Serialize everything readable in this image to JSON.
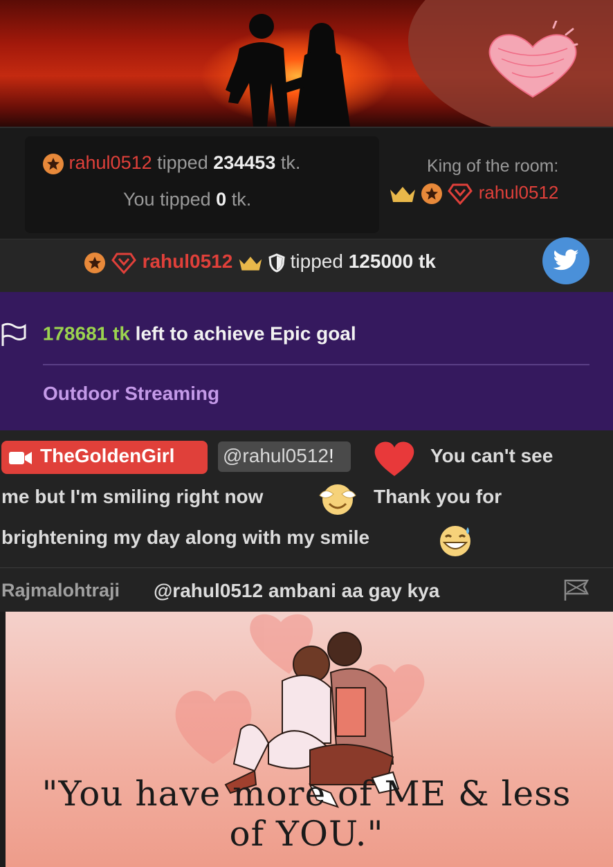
{
  "tip_summary": {
    "tipper": "rahul0512",
    "tipped_word": "tipped",
    "amount": "234453",
    "unit": "tk.",
    "you_tipped_label": "You tipped",
    "you_tipped_amount": "0",
    "you_tipped_unit": "tk.",
    "king_label": "King of the room:",
    "king_user": "rahul0512"
  },
  "tip_notification": {
    "user": "rahul0512",
    "tipped_word": "tipped",
    "amount": "125000 tk"
  },
  "goal": {
    "amount": "178681 tk",
    "text": "left to achieve Epic goal",
    "subtitle": "Outdoor Streaming"
  },
  "chat": [
    {
      "user": "TheGoldenGirl",
      "mention": "@rahul0512",
      "after_mention": "!",
      "line1_tail": "You can't see",
      "line2": "me but I'm smiling right now",
      "line2b": "Thank you for",
      "line3": "brightening my day along with my smile"
    },
    {
      "user": "Rajmalohtraji",
      "message": "@rahul0512  ambani aa gay kya"
    }
  ],
  "quote": {
    "line1": "\"You have more of ME & less",
    "line2": "of YOU.\""
  },
  "colors": {
    "accent_red": "#e0403a",
    "goal_purple": "#35195e",
    "goal_green": "#9bd34f",
    "twitter_blue": "#4a90d9"
  },
  "icons": [
    "star-coin-icon",
    "diamond-heart-icon",
    "crown-icon",
    "shield-icon",
    "twitter-icon",
    "flag-icon",
    "camera-icon",
    "heart-icon",
    "smiling-face-icon",
    "grinning-sweat-icon",
    "report-flag-icon"
  ]
}
